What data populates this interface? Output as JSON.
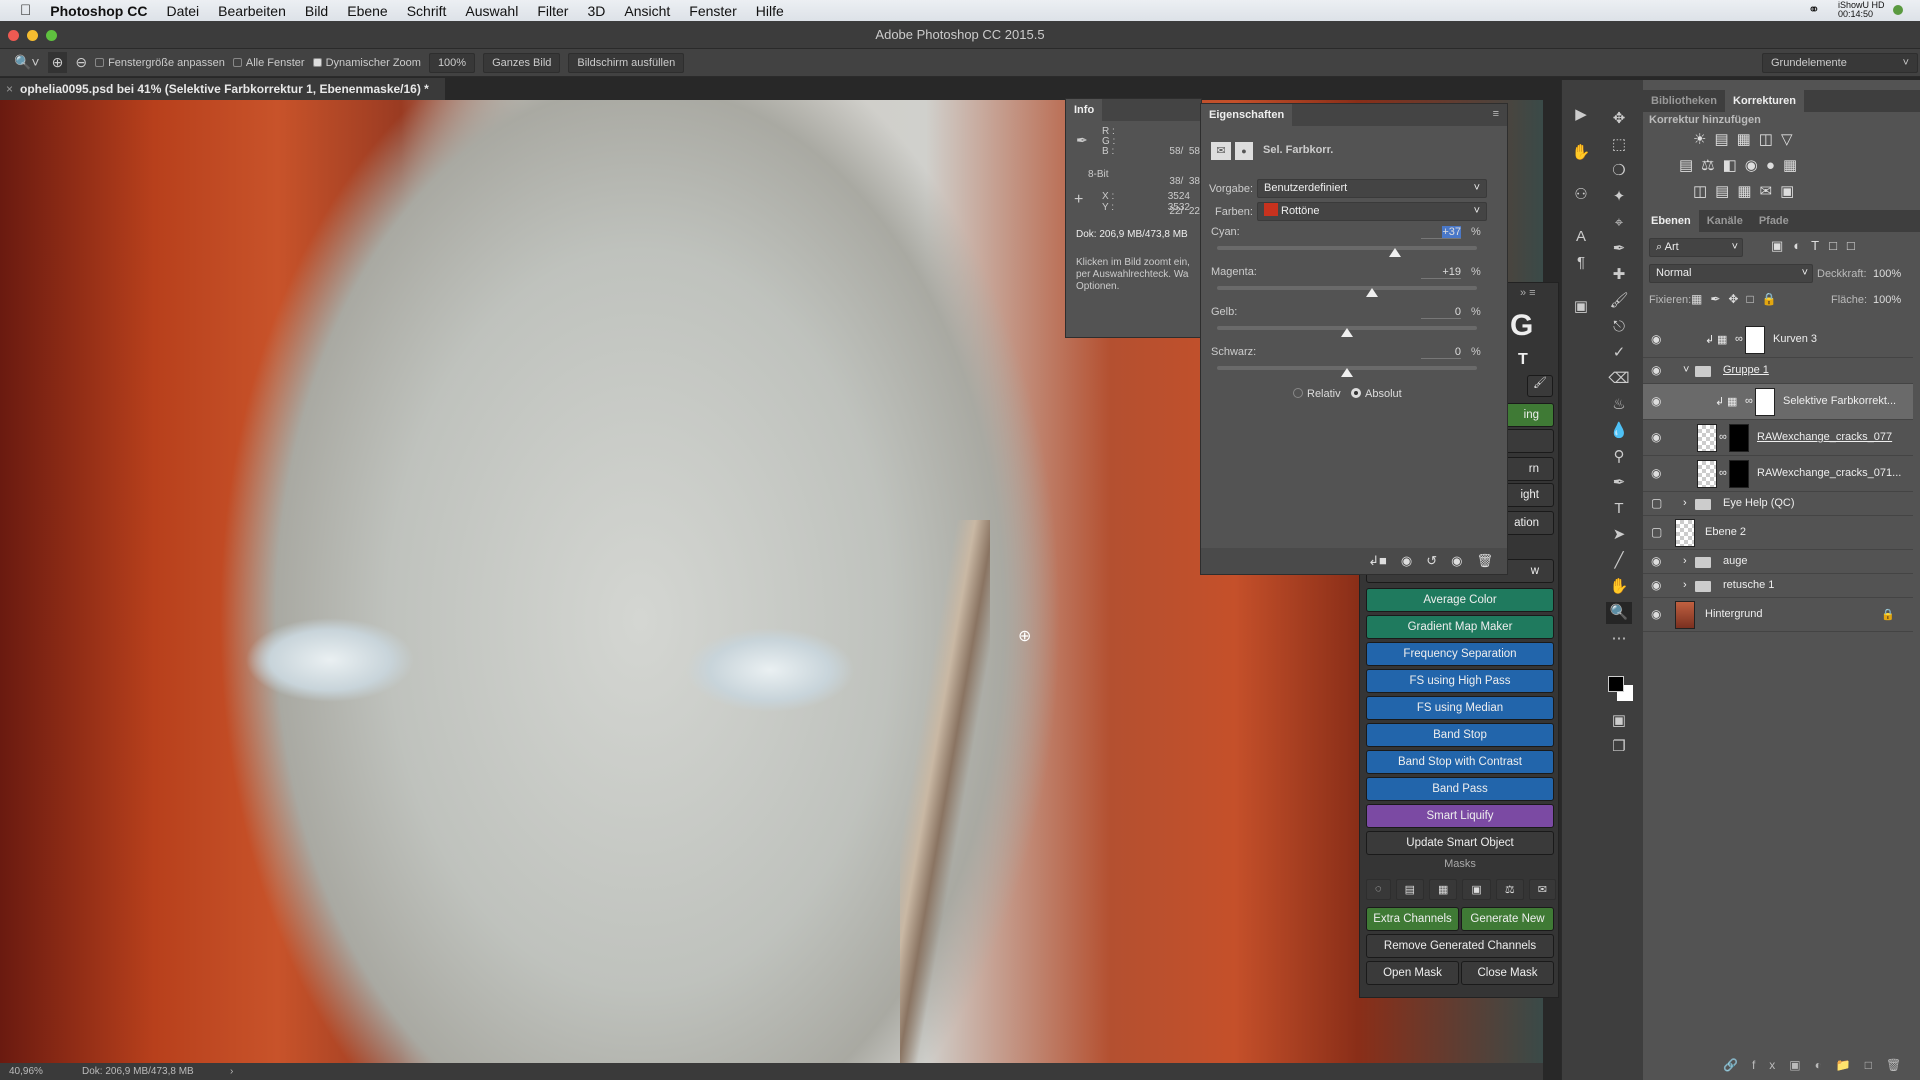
{
  "menubar": {
    "app": "Photoshop CC",
    "items": [
      "Datei",
      "Bearbeiten",
      "Bild",
      "Ebene",
      "Schrift",
      "Auswahl",
      "Filter",
      "3D",
      "Ansicht",
      "Fenster",
      "Hilfe"
    ],
    "recorder_name": "iShowU HD",
    "recorder_time": "00:14:50"
  },
  "window": {
    "title": "Adobe Photoshop CC 2015.5"
  },
  "options": {
    "fit_window": "Fenstergröße anpassen",
    "fit_window_checked": false,
    "all_windows": "Alle Fenster",
    "all_windows_checked": false,
    "scrubby_zoom": "Dynamischer Zoom",
    "scrubby_zoom_checked": true,
    "btn_100": "100%",
    "btn_fit": "Ganzes Bild",
    "btn_fill": "Bildschirm ausfüllen",
    "workspace": "Grundelemente"
  },
  "document": {
    "tab": "ophelia0095.psd bei 41% (Selektive Farbkorrektur 1, Ebenenmaske/16) *"
  },
  "status": {
    "zoom": "40,96%",
    "doc": "Dok: 206,9 MB/473,8 MB"
  },
  "info": {
    "title": "Info",
    "r_label": "R :",
    "g_label": "G :",
    "b_label": "B :",
    "r": "58/  58",
    "g": "38/  38",
    "b": "22/  22",
    "bit": "8-Bit",
    "x_label": "X :",
    "y_label": "Y :",
    "x": "3524",
    "y": "3532",
    "doc": "Dok: 206,9 MB/473,8 MB",
    "hint": "Klicken im Bild zoomt ein, per Auswahlrechteck. Wa Optionen."
  },
  "properties": {
    "title": "Eigenschaften",
    "type": "Sel. Farbkorr.",
    "preset_label": "Vorgabe:",
    "preset": "Benutzerdefiniert",
    "colors_label": "Farben:",
    "colors": "Rottöne",
    "swatch": "#c8321e",
    "sliders": [
      {
        "label": "Cyan:",
        "value": "+37",
        "num": 37
      },
      {
        "label": "Magenta:",
        "value": "+19",
        "num": 19
      },
      {
        "label": "Gelb:",
        "value": "0",
        "num": 0
      },
      {
        "label": "Schwarz:",
        "value": "0",
        "num": 0
      }
    ],
    "unit": "%",
    "relative": "Relativ",
    "absolute": "Absolut",
    "mode": "absolute"
  },
  "plugin": {
    "partial": [
      "ing",
      "",
      "rn",
      "ight",
      "ation",
      "w"
    ],
    "buttons": [
      {
        "label": "Average Color",
        "color": "#1f7a5e"
      },
      {
        "label": "Gradient Map Maker",
        "color": "#1f7a5e"
      },
      {
        "label": "Frequency Separation",
        "color": "#2265ab"
      },
      {
        "label": "FS using High Pass",
        "color": "#2265ab"
      },
      {
        "label": "FS using Median",
        "color": "#2265ab"
      },
      {
        "label": "Band Stop",
        "color": "#2265ab"
      },
      {
        "label": "Band Stop with Contrast",
        "color": "#2265ab"
      },
      {
        "label": "Band Pass",
        "color": "#2265ab"
      },
      {
        "label": "Smart Liquify",
        "color": "#7b4aa3"
      },
      {
        "label": "Update Smart Object",
        "color": "#3a3a3a"
      }
    ],
    "masks_label": "Masks",
    "extra": "Extra Channels",
    "generate": "Generate New",
    "remove": "Remove Generated Channels",
    "open": "Open Mask",
    "close": "Close Mask"
  },
  "right": {
    "tabs_top": [
      "Bibliotheken",
      "Korrekturen"
    ],
    "add_adjustment": "Korrektur hinzufügen",
    "tabs_layers": [
      "Ebenen",
      "Kanäle",
      "Pfade"
    ],
    "filter": "Art",
    "blend": "Normal",
    "opacity_label": "Deckkraft:",
    "opacity": "100%",
    "lock_label": "Fixieren:",
    "fill_label": "Fläche:",
    "fill": "100%",
    "layers": [
      {
        "name": "Kurven 3",
        "visible": true
      },
      {
        "name": "Gruppe 1",
        "visible": true
      },
      {
        "name": "Selektive Farbkorrekt...",
        "visible": true
      },
      {
        "name": "RAWexchange_cracks_077",
        "visible": true
      },
      {
        "name": "RAWexchange_cracks_071...",
        "visible": true
      },
      {
        "name": "Eye Help (QC)",
        "visible": false
      },
      {
        "name": "Ebene 2",
        "visible": false
      },
      {
        "name": "auge",
        "visible": true
      },
      {
        "name": "retusche 1",
        "visible": true
      },
      {
        "name": "Hintergrund",
        "visible": true
      }
    ]
  }
}
